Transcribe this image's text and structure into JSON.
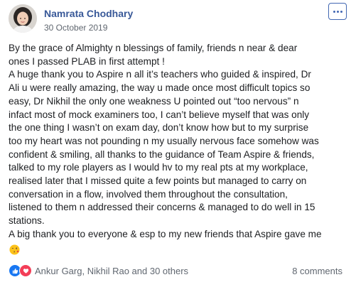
{
  "post": {
    "author": "Namrata Chodhary",
    "date": "30 October 2019",
    "more_icon": "more-horizontal-icon",
    "body_lines": [
      "By the grace of Almighty n blessings of family, friends n near & dear",
      "ones I passed PLAB in first attempt !",
      "A huge thank you to Aspire n all it’s teachers who guided & inspired, Dr",
      "Ali u were really amazing, the way u made once most difficult topics so",
      "easy, Dr Nikhil the only one weakness U pointed out “too nervous” n",
      "infact most of mock examiners too, I can’t believe myself that was only",
      "the one thing I wasn’t on exam day, don’t know how but to my surprise",
      "too my heart was not pounding n my usually nervous face somehow was",
      "confident & smiling, all thanks to the guidance of Team Aspire & friends,",
      "talked to my role players as I would hv to my real pts at my workplace,",
      "realised later that I missed quite a few points but managed to carry on",
      "conversation in a flow, involved them throughout the consultation,",
      "listened to them n addressed their concerns & managed to do well in 15",
      "stations.",
      "A big thank you to everyone & esp to my new friends that Aspire gave me"
    ],
    "emoji": "blowing-kiss-emoji"
  },
  "footer": {
    "reaction_icons": [
      "like-icon",
      "love-icon"
    ],
    "reactions_text": "Ankur Garg, Nikhil Rao and 30 others",
    "comments_text": "8 comments"
  },
  "colors": {
    "author_link": "#385898",
    "secondary_text": "#606770",
    "like_blue": "#1877f2",
    "love_red": "#f33e58"
  }
}
